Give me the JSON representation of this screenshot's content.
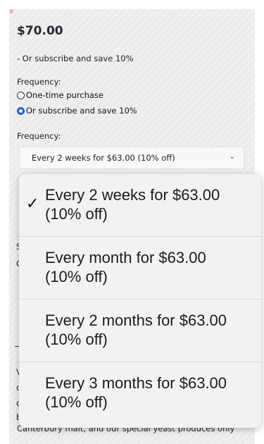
{
  "product": {
    "price": "$70.00",
    "subscribe_note": "- Or subscribe and save 10%"
  },
  "frequency_section": {
    "label": "Frequency:",
    "options": [
      {
        "label": "One-time purchase",
        "selected": false
      },
      {
        "label": "Or subscribe and save 10%",
        "selected": true
      }
    ]
  },
  "frequency_select": {
    "label": "Frequency:",
    "value": "Every 2 weeks for $63.00 (10% off)",
    "chevron_icon": "chevron-down-icon"
  },
  "dropdown": {
    "options": [
      {
        "label_line1": "Every 2 weeks for $63.00",
        "label_line2": "(10% off)",
        "checked": true
      },
      {
        "label_line1": "Every month for $63.00",
        "label_line2": "(10% off)",
        "checked": false
      },
      {
        "label_line1": "Every 2 months for $63.00",
        "label_line2": "(10% off)",
        "checked": false
      },
      {
        "label_line1": "Every 3 months for $63.00",
        "label_line2": "(10% off)",
        "checked": false
      }
    ],
    "check_glyph": "✓"
  },
  "description": {
    "visible_line": "Canterbury malt, and our special yeast produces only"
  },
  "colors": {
    "radio_selected": "#1565d8",
    "page_bg": "#ebebeb",
    "price_text": "#222a33"
  }
}
